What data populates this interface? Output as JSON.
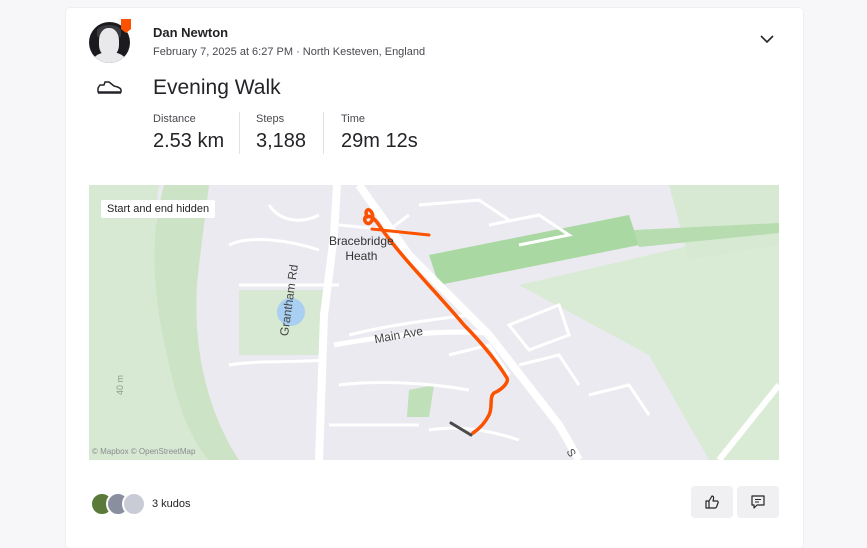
{
  "athlete": {
    "name": "Dan Newton",
    "date_location": "February 7, 2025 at 6:27 PM · North Kesteven, England"
  },
  "activity": {
    "title": "Evening Walk",
    "icon": "shoe-icon",
    "stats": [
      {
        "label": "Distance",
        "value": "2.53 km"
      },
      {
        "label": "Steps",
        "value": "3,188"
      },
      {
        "label": "Time",
        "value": "29m 12s"
      }
    ]
  },
  "map": {
    "hidden_notice": "Start and end hidden",
    "attribution": "© Mapbox © OpenStreetMap",
    "labels": {
      "town_line1": "Bracebridge",
      "town_line2": "Heath",
      "road1": "Grantham Rd",
      "road2": "Main Ave",
      "road3": "S",
      "contour": "40 m"
    }
  },
  "kudos": {
    "text": "3 kudos"
  },
  "colors": {
    "route": "#fc5200",
    "brand": "#fc5200"
  }
}
